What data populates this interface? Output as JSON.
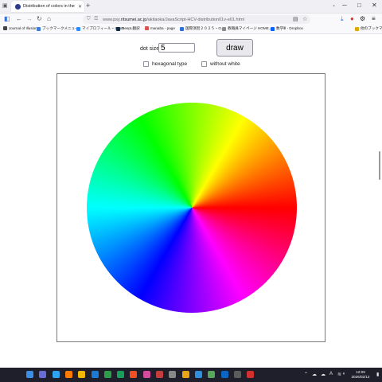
{
  "browser": {
    "tab": {
      "title": "Distribution of colors in the HCV space"
    },
    "url": {
      "prefix": "www.psy.",
      "host": "ritsumei.ac.jp",
      "path": "/akitaoka/JavaScript-HCV-distribution01v-e01.html"
    },
    "bookmarks": [
      {
        "label": "Journal of Illusion",
        "color": "#444444"
      },
      {
        "label": "ブックマークメニュー",
        "color": "#3b7dd8"
      },
      {
        "label": "マイプロフィール・Zoom",
        "color": "#2d8cff"
      },
      {
        "label": "DeepL翻訳",
        "color": "#0f2b46"
      },
      {
        "label": "manaba - page",
        "color": "#d9534f"
      },
      {
        "label": "国際演習２０２５・O...",
        "color": "#2f6fd6"
      },
      {
        "label": "教職員マイページ HOME...",
        "color": "#8a8a8a"
      },
      {
        "label": "数学Ⅲ - Dropbox",
        "color": "#0061ff"
      },
      {
        "label": "他のブックマーク",
        "color": "#e0a800"
      }
    ]
  },
  "controls": {
    "dot_size_label": "dot size",
    "dot_size_value": "5",
    "draw_label": "draw",
    "hexagonal_label": "hexagonal type",
    "without_white_label": "without white"
  },
  "taskbar": {
    "time": "12:09",
    "date": "2026/02/12",
    "icons": [
      "#3a8ee6",
      "#6b6bd6",
      "#2ea3f2",
      "#ff7a00",
      "#f2b705",
      "#1b7bd4",
      "#2e9d4a",
      "#1a9e5c",
      "#f25022",
      "#d44b9c",
      "#c33d3d",
      "#888888",
      "#e8a317",
      "#2f8fdd",
      "#58a55c",
      "#0a66c2",
      "#5b5b5b",
      "#d32f2f"
    ]
  }
}
